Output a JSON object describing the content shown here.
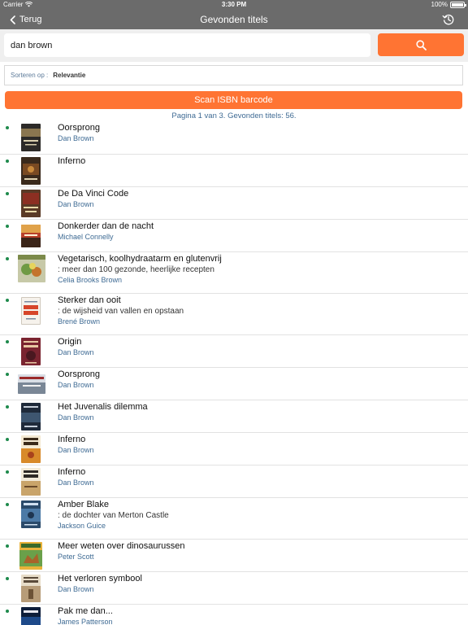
{
  "status_bar": {
    "carrier": "Carrier",
    "time": "3:30 PM",
    "battery": "100%"
  },
  "nav": {
    "back_label": "Terug",
    "title": "Gevonden titels"
  },
  "search": {
    "value": "dan brown"
  },
  "sort": {
    "label": "Sorteren op :",
    "value": "Relevantie"
  },
  "scan_button_label": "Scan ISBN barcode",
  "pagination": "Pagina 1 van 3. Gevonden titels: 56.",
  "results": [
    {
      "title": "Oorsprong",
      "subtitle": "",
      "author": "Dan Brown"
    },
    {
      "title": "Inferno",
      "subtitle": "",
      "author": ""
    },
    {
      "title": "De Da Vinci Code",
      "subtitle": "",
      "author": "Dan Brown"
    },
    {
      "title": "Donkerder dan de nacht",
      "subtitle": "",
      "author": "Michael Connelly"
    },
    {
      "title": "Vegetarisch, koolhydraatarm en glutenvrij",
      "subtitle": ": meer dan 100 gezonde, heerlijke recepten",
      "author": "Celia Brooks Brown"
    },
    {
      "title": "Sterker dan ooit",
      "subtitle": ": de wijsheid van vallen en opstaan",
      "author": "Brené Brown"
    },
    {
      "title": "Origin",
      "subtitle": "",
      "author": "Dan Brown"
    },
    {
      "title": "Oorsprong",
      "subtitle": "",
      "author": "Dan Brown"
    },
    {
      "title": "Het Juvenalis dilemma",
      "subtitle": "",
      "author": "Dan Brown"
    },
    {
      "title": "Inferno",
      "subtitle": "",
      "author": "Dan Brown"
    },
    {
      "title": "Inferno",
      "subtitle": "",
      "author": "Dan Brown"
    },
    {
      "title": "Amber Blake",
      "subtitle": ": de dochter van Merton Castle",
      "author": "Jackson Guice"
    },
    {
      "title": "Meer weten over dinosaurussen",
      "subtitle": "",
      "author": "Peter Scott"
    },
    {
      "title": "Het verloren symbool",
      "subtitle": "",
      "author": "Dan Brown"
    },
    {
      "title": "Pak me dan...",
      "subtitle": "",
      "author": "James Patterson"
    }
  ],
  "colors": {
    "header_bg": "#6b6b6b",
    "accent_orange": "#ff7433",
    "link_blue": "#3f6b94",
    "bullet_green": "#1e8a4c"
  }
}
